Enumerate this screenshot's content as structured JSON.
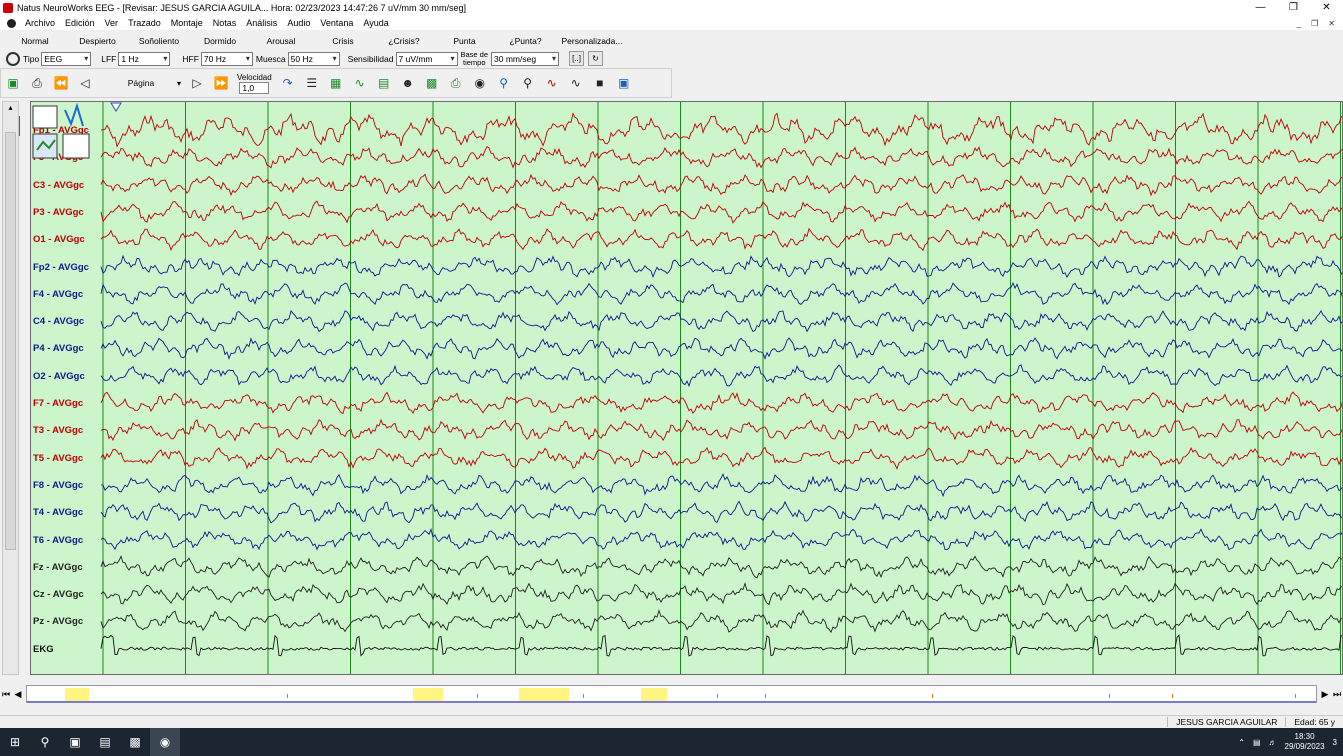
{
  "window": {
    "title": "Natus NeuroWorks EEG - [Revisar:  JESUS  GARCIA AGUILA...  Hora: 02/23/2023 14:47:26  7 uV/mm  30 mm/seg]",
    "controls": [
      "—",
      "❐",
      "✕"
    ]
  },
  "menu": {
    "items": [
      "Archivo",
      "Edición",
      "Ver",
      "Trazado",
      "Montaje",
      "Notas",
      "Análisis",
      "Audio",
      "Ventana",
      "Ayuda"
    ],
    "mdi_controls": [
      "_",
      "❐",
      "✕"
    ]
  },
  "montage_tabs": [
    "Normal",
    "Despierto",
    "Soñoliento",
    "Dormido",
    "Arousal",
    "Crisis",
    "¿Crisis?",
    "Punta",
    "¿Punta?",
    "Personalizada..."
  ],
  "options": {
    "tipo_label": "Tipo",
    "tipo_value": "EEG",
    "lff_label": "LFF",
    "lff_value": "1 Hz",
    "hff_label": "HFF",
    "hff_value": "70 Hz",
    "muesca_label": "Muesca",
    "muesca_value": "50 Hz",
    "sens_label": "Sensibilidad",
    "sens_value": "7 uV/mm",
    "base_label_1": "Base de",
    "base_label_2": "tiempo",
    "base_value": "30 mm/seg",
    "btn_bracket": "[..]",
    "btn_refresh": "↻"
  },
  "toolbar": {
    "page_label": "Página",
    "speed_label": "Velocidad",
    "speed_value": "1,0"
  },
  "channels": [
    {
      "label": "Fp1 - AVGgc",
      "color": "#c00000"
    },
    {
      "label": "F3 - AVGgc",
      "color": "#c00000"
    },
    {
      "label": "C3 - AVGgc",
      "color": "#c00000"
    },
    {
      "label": "P3 - AVGgc",
      "color": "#c00000"
    },
    {
      "label": "O1 - AVGgc",
      "color": "#c00000"
    },
    {
      "label": "Fp2 - AVGgc",
      "color": "#0a1c8c"
    },
    {
      "label": "F4 - AVGgc",
      "color": "#0a1c8c"
    },
    {
      "label": "C4 - AVGgc",
      "color": "#0a1c8c"
    },
    {
      "label": "P4 - AVGgc",
      "color": "#0a1c8c"
    },
    {
      "label": "O2 - AVGgc",
      "color": "#0a1c8c"
    },
    {
      "label": "F7 - AVGgc",
      "color": "#c00000"
    },
    {
      "label": "T3 - AVGgc",
      "color": "#c00000"
    },
    {
      "label": "T5 - AVGgc",
      "color": "#c00000"
    },
    {
      "label": "F8 - AVGgc",
      "color": "#0a1c8c"
    },
    {
      "label": "T4 - AVGgc",
      "color": "#0a1c8c"
    },
    {
      "label": "T6 - AVGgc",
      "color": "#0a1c8c"
    },
    {
      "label": "Fz - AVGgc",
      "color": "#222222"
    },
    {
      "label": "Cz - AVGgc",
      "color": "#222222"
    },
    {
      "label": "Pz - AVGgc",
      "color": "#222222"
    },
    {
      "label": "EKG",
      "color": "#111111"
    }
  ],
  "colors": {
    "chart_bg": "#ccf5cc",
    "gridline": "#1a8a1a",
    "left_hemisphere": "#c00000",
    "right_hemisphere": "#0a1c8c",
    "midline": "#222222",
    "navigator_highlight": "#fff580"
  },
  "status": {
    "patient": "JESUS  GARCIA AGUILAR",
    "age": "Edad: 65 y"
  },
  "taskbar": {
    "time": "18:30",
    "date": "29/09/2023",
    "notification_count": "3"
  }
}
